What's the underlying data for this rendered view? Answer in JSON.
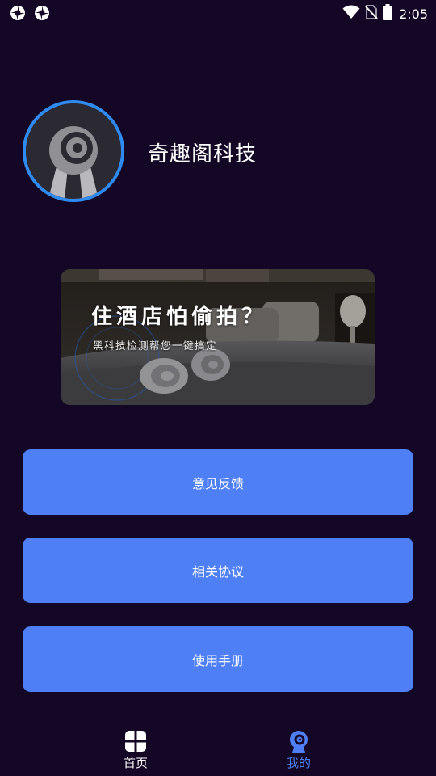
{
  "status_bar": {
    "time": "2:05",
    "icons": [
      "app-notification-icon",
      "app-notification-icon",
      "wifi-icon",
      "no-sim-icon",
      "battery-icon"
    ]
  },
  "profile": {
    "name": "奇趣阁科技",
    "avatar": "camera-logo-icon",
    "ring_color": "#2f8bf2"
  },
  "banner": {
    "title": "住酒店怕偷拍？",
    "subtitle": "黑科技检测帮您一键搞定"
  },
  "menu": {
    "feedback_label": "意见反馈",
    "agreement_label": "相关协议",
    "manual_label": "使用手册",
    "button_color": "#4e7ff5"
  },
  "bottom_nav": {
    "home_label": "首页",
    "mine_label": "我的",
    "active": "mine",
    "active_color": "#4e7ff5"
  },
  "colors": {
    "background": "#140726"
  }
}
